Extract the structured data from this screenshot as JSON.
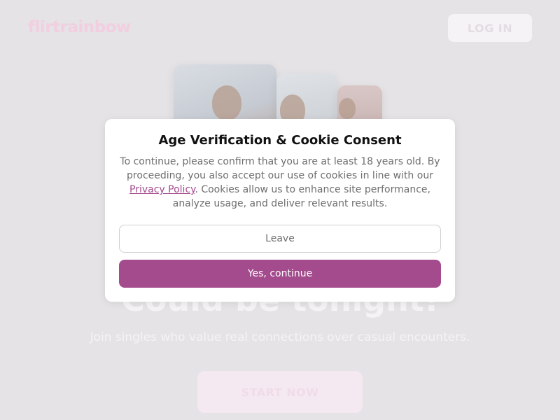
{
  "header": {
    "logo_text": "flirtrainbow",
    "login_label": "LOG IN"
  },
  "hero": {
    "headline": "Could be tonight!",
    "subline": "Join singles who value real connections over casual encounters.",
    "cta_label": "START NOW"
  },
  "modal": {
    "title": "Age Verification & Cookie Consent",
    "text_before_link": "To continue, please confirm that you are at least 18 years old. By proceeding, you also accept our use of cookies in line with our ",
    "privacy_link_label": "Privacy Policy",
    "text_after_link": ". Cookies allow us to enhance site performance, analyze usage, and deliver relevant results.",
    "leave_label": "Leave",
    "continue_label": "Yes, continue"
  },
  "colors": {
    "accent": "#a44b8d",
    "overlay_bg": "#e5e3e5",
    "logo": "#f1cfe0"
  }
}
